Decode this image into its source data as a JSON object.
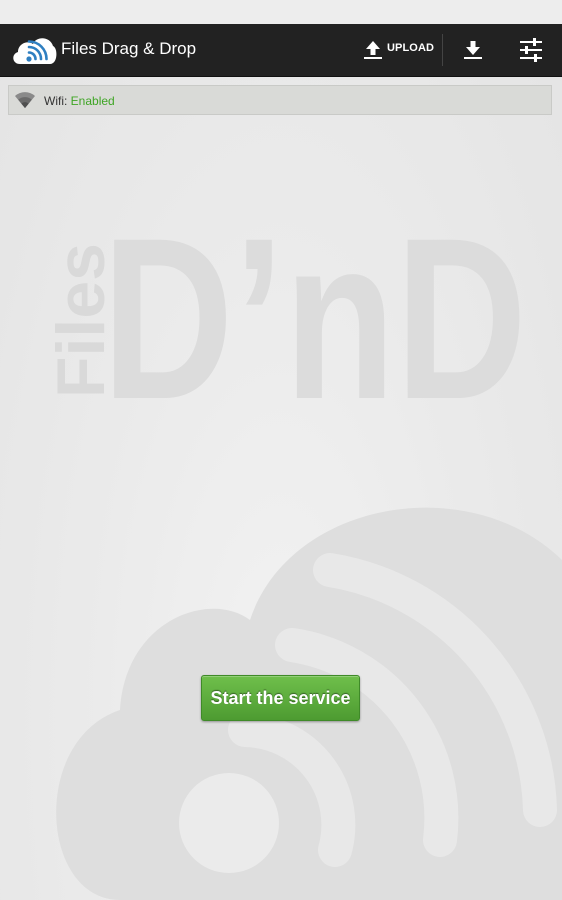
{
  "app": {
    "title": "Files Drag & Drop",
    "logo_icon": "cloud-wifi-icon",
    "brand_color": "#2f7fc1"
  },
  "action_bar": {
    "upload_label": "UPLOAD",
    "upload_icon": "upload-icon",
    "download_icon": "download-icon",
    "settings_icon": "sliders-icon"
  },
  "wifi": {
    "label": "Wifi:",
    "status": "Enabled",
    "status_color": "#3fa525",
    "icon": "wifi-icon"
  },
  "watermark": {
    "files_text": "Files",
    "dnd_text": "D’nD"
  },
  "main": {
    "start_button_label": "Start the service",
    "button_color": "#5aa83a"
  }
}
